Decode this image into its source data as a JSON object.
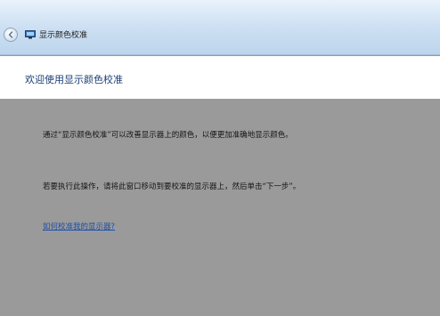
{
  "window": {
    "title": "显示颜色校准",
    "back_icon": "back-arrow-icon",
    "app_icon": "monitor-icon",
    "accent": "#1b3f73",
    "titlebar_color": "#cfe1f3"
  },
  "header": {
    "title": "欢迎使用显示颜色校准"
  },
  "content": {
    "paragraph1": "通过“显示颜色校准”可以改善显示器上的颜色，以便更加准确地显示颜色。",
    "paragraph2": "若要执行此操作，请将此窗口移动到要校准的显示器上，然后单击“下一步”。",
    "help_link": "如何校准我的显示器?",
    "link_color": "#1f4fa8",
    "background": "#9a9a9a"
  }
}
